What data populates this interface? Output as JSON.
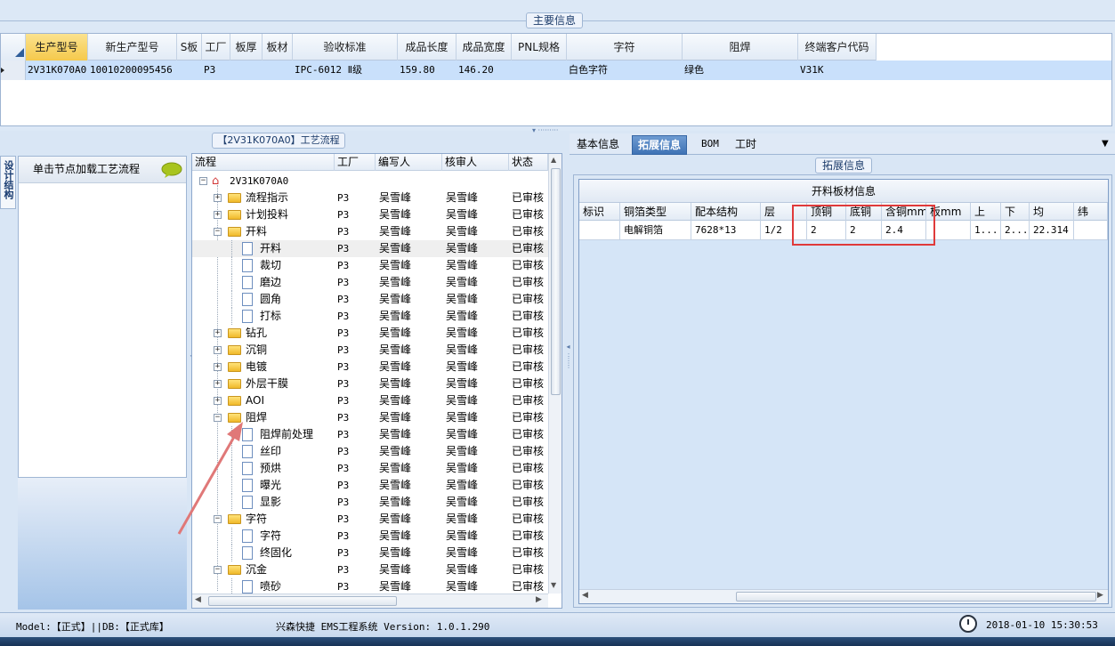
{
  "main_info": {
    "title": "主要信息",
    "columns": [
      "生产型号",
      "新生产型号",
      "S板",
      "工厂",
      "板厚",
      "板材",
      "验收标准",
      "成品长度",
      "成品宽度",
      "PNL规格",
      "字符",
      "阻焊",
      "终端客户代码"
    ],
    "row": [
      "2V31K070A0",
      "10010200095456",
      "",
      "P3",
      "",
      "",
      "IPC-6012 Ⅱ级",
      "159.80",
      "146.20",
      "",
      "白色字符",
      "绿色",
      "V31K"
    ]
  },
  "left_panel": {
    "tab_label": "设计结构",
    "box_title": "单击节点加载工艺流程"
  },
  "process_tree": {
    "title": "【2V31K070A0】工艺流程",
    "columns": [
      "流程",
      "工厂",
      "编写人",
      "核审人",
      "状态"
    ],
    "root": "2V31K070A0",
    "rows": [
      {
        "label": "流程指示",
        "level": 1,
        "type": "folder",
        "expander": "+",
        "factory": "P3",
        "writer": "吴雪峰",
        "reviewer": "吴雪峰",
        "status": "已审核"
      },
      {
        "label": "计划投料",
        "level": 1,
        "type": "folder",
        "expander": "+",
        "factory": "P3",
        "writer": "吴雪峰",
        "reviewer": "吴雪峰",
        "status": "已审核"
      },
      {
        "label": "开料",
        "level": 1,
        "type": "folder",
        "expander": "−",
        "factory": "P3",
        "writer": "吴雪峰",
        "reviewer": "吴雪峰",
        "status": "已审核"
      },
      {
        "label": "开料",
        "level": 2,
        "type": "doc",
        "expander": "",
        "factory": "P3",
        "writer": "吴雪峰",
        "reviewer": "吴雪峰",
        "status": "已审核",
        "selected": true
      },
      {
        "label": "裁切",
        "level": 2,
        "type": "doc",
        "expander": "",
        "factory": "P3",
        "writer": "吴雪峰",
        "reviewer": "吴雪峰",
        "status": "已审核"
      },
      {
        "label": "磨边",
        "level": 2,
        "type": "doc",
        "expander": "",
        "factory": "P3",
        "writer": "吴雪峰",
        "reviewer": "吴雪峰",
        "status": "已审核"
      },
      {
        "label": "圆角",
        "level": 2,
        "type": "doc",
        "expander": "",
        "factory": "P3",
        "writer": "吴雪峰",
        "reviewer": "吴雪峰",
        "status": "已审核"
      },
      {
        "label": "打标",
        "level": 2,
        "type": "doc",
        "expander": "",
        "factory": "P3",
        "writer": "吴雪峰",
        "reviewer": "吴雪峰",
        "status": "已审核"
      },
      {
        "label": "钻孔",
        "level": 1,
        "type": "folder",
        "expander": "+",
        "factory": "P3",
        "writer": "吴雪峰",
        "reviewer": "吴雪峰",
        "status": "已审核"
      },
      {
        "label": "沉铜",
        "level": 1,
        "type": "folder",
        "expander": "+",
        "factory": "P3",
        "writer": "吴雪峰",
        "reviewer": "吴雪峰",
        "status": "已审核"
      },
      {
        "label": "电镀",
        "level": 1,
        "type": "folder",
        "expander": "+",
        "factory": "P3",
        "writer": "吴雪峰",
        "reviewer": "吴雪峰",
        "status": "已审核"
      },
      {
        "label": "外层干膜",
        "level": 1,
        "type": "folder",
        "expander": "+",
        "factory": "P3",
        "writer": "吴雪峰",
        "reviewer": "吴雪峰",
        "status": "已审核"
      },
      {
        "label": "AOI",
        "level": 1,
        "type": "folder",
        "expander": "+",
        "factory": "P3",
        "writer": "吴雪峰",
        "reviewer": "吴雪峰",
        "status": "已审核"
      },
      {
        "label": "阻焊",
        "level": 1,
        "type": "folder",
        "expander": "−",
        "factory": "P3",
        "writer": "吴雪峰",
        "reviewer": "吴雪峰",
        "status": "已审核"
      },
      {
        "label": "阻焊前处理",
        "level": 2,
        "type": "doc",
        "expander": "",
        "factory": "P3",
        "writer": "吴雪峰",
        "reviewer": "吴雪峰",
        "status": "已审核"
      },
      {
        "label": "丝印",
        "level": 2,
        "type": "doc",
        "expander": "",
        "factory": "P3",
        "writer": "吴雪峰",
        "reviewer": "吴雪峰",
        "status": "已审核"
      },
      {
        "label": "预烘",
        "level": 2,
        "type": "doc",
        "expander": "",
        "factory": "P3",
        "writer": "吴雪峰",
        "reviewer": "吴雪峰",
        "status": "已审核"
      },
      {
        "label": "曝光",
        "level": 2,
        "type": "doc",
        "expander": "",
        "factory": "P3",
        "writer": "吴雪峰",
        "reviewer": "吴雪峰",
        "status": "已审核"
      },
      {
        "label": "显影",
        "level": 2,
        "type": "doc",
        "expander": "",
        "factory": "P3",
        "writer": "吴雪峰",
        "reviewer": "吴雪峰",
        "status": "已审核"
      },
      {
        "label": "字符",
        "level": 1,
        "type": "folder",
        "expander": "−",
        "factory": "P3",
        "writer": "吴雪峰",
        "reviewer": "吴雪峰",
        "status": "已审核"
      },
      {
        "label": "字符",
        "level": 2,
        "type": "doc",
        "expander": "",
        "factory": "P3",
        "writer": "吴雪峰",
        "reviewer": "吴雪峰",
        "status": "已审核"
      },
      {
        "label": "终固化",
        "level": 2,
        "type": "doc",
        "expander": "",
        "factory": "P3",
        "writer": "吴雪峰",
        "reviewer": "吴雪峰",
        "status": "已审核"
      },
      {
        "label": "沉金",
        "level": 1,
        "type": "folder",
        "expander": "−",
        "factory": "P3",
        "writer": "吴雪峰",
        "reviewer": "吴雪峰",
        "status": "已审核"
      },
      {
        "label": "喷砂",
        "level": 2,
        "type": "doc",
        "expander": "",
        "factory": "P3",
        "writer": "吴雪峰",
        "reviewer": "吴雪峰",
        "status": "已审核"
      }
    ]
  },
  "right_tabs": [
    "基本信息",
    "拓展信息",
    "BOM",
    "工时"
  ],
  "right_active_tab": "拓展信息",
  "ext_info": {
    "group_title": "拓展信息",
    "grid_title": "开料板材信息",
    "columns": [
      "标识",
      "铜箔类型",
      "配本结构",
      "层",
      "顶铜",
      "底铜",
      "含铜mm",
      "板mm",
      "上",
      "下",
      "均",
      "纬"
    ],
    "row": [
      "",
      "电解铜箔",
      "7628*13",
      "1/2",
      "2",
      "2",
      "2.4",
      "",
      "1...",
      "2...",
      "22.314",
      ""
    ]
  },
  "status_bar": {
    "model": "Model:【正式】||DB:【正式库】",
    "app": "兴森快捷 EMS工程系统 Version: 1.0.1.290",
    "datetime": "2018-01-10 15:30:53"
  },
  "colors": {
    "selected_header": "#f5c94c",
    "selected_row": "#c9e0fb",
    "active_tab": "#3f73b5",
    "annotation_red": "#e03a3a"
  }
}
